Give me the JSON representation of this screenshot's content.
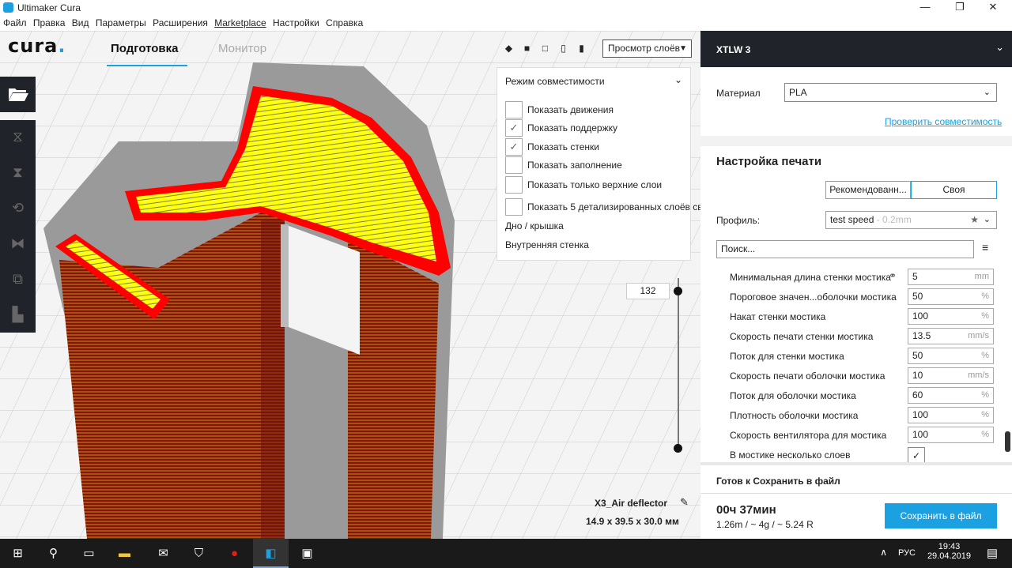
{
  "window": {
    "title": "Ultimaker Cura",
    "minimize": "—",
    "maximize": "❐",
    "close": "✕"
  },
  "menu": [
    "Файл",
    "Правка",
    "Вид",
    "Параметры",
    "Расширения",
    "Marketplace",
    "Настройки",
    "Справка"
  ],
  "header": {
    "logo": "cura",
    "tab_prepare": "Подготовка",
    "tab_monitor": "Монитор",
    "view_select": "Просмотр слоёв"
  },
  "compat_panel": {
    "title": "Режим совместимости",
    "options": [
      {
        "label": "Показать движения",
        "checked": false
      },
      {
        "label": "Показать поддержку",
        "checked": true
      },
      {
        "label": "Показать стенки",
        "checked": true
      },
      {
        "label": "Показать заполнение",
        "checked": false
      },
      {
        "label": "Показать только верхние слои",
        "checked": false
      },
      {
        "label": "Показать 5 детализированных слоёв св",
        "checked": false
      }
    ],
    "extra": [
      "Дно / крышка",
      "Внутренняя стенка"
    ]
  },
  "layer_slider": {
    "value": "132"
  },
  "object": {
    "name": "X3_Air deflector",
    "dims": "14.9 x 39.5 x 30.0 мм"
  },
  "right_panel": {
    "printer": "XTLW 3",
    "material_label": "Материал",
    "material_value": "PLA",
    "check_compat": "Проверить совместимость",
    "print_setup_title": "Настройка печати",
    "mode_recommended": "Рекомендованн...",
    "mode_custom": "Своя",
    "profile_label": "Профиль:",
    "profile_value": "test speed",
    "profile_sub": " - 0.2mm",
    "search_placeholder": "Поиск...",
    "settings": [
      {
        "label": "Минимальная длина стенки мостика",
        "value": "5",
        "unit": "mm",
        "linked": true
      },
      {
        "label": "Пороговое значен...оболочки мостика",
        "value": "50",
        "unit": "%"
      },
      {
        "label": "Накат стенки мостика",
        "value": "100",
        "unit": "%"
      },
      {
        "label": "Скорость печати стенки мостика",
        "value": "13.5",
        "unit": "mm/s"
      },
      {
        "label": "Поток для стенки мостика",
        "value": "50",
        "unit": "%"
      },
      {
        "label": "Скорость печати оболочки мостика",
        "value": "10",
        "unit": "mm/s"
      },
      {
        "label": "Поток для оболочки мостика",
        "value": "60",
        "unit": "%"
      },
      {
        "label": "Плотность оболочки мостика",
        "value": "100",
        "unit": "%"
      },
      {
        "label": "Скорость вентилятора для мостика",
        "value": "100",
        "unit": "%"
      }
    ],
    "multi_layer_label": "В мостике несколько слоев",
    "ready_text": "Готов к Сохранить в файл",
    "print_time": "00ч 37мин",
    "print_stats": "1.26m / ~ 4g / ~ 5.24 R",
    "save_button": "Сохранить в файл"
  },
  "taskbar": {
    "lang": "РУС",
    "time": "19:43",
    "date": "29.04.2019"
  },
  "colors": {
    "accent": "#1ba0e2",
    "dark": "#202329",
    "wall": "#ff0000",
    "infill": "#ffff00"
  }
}
